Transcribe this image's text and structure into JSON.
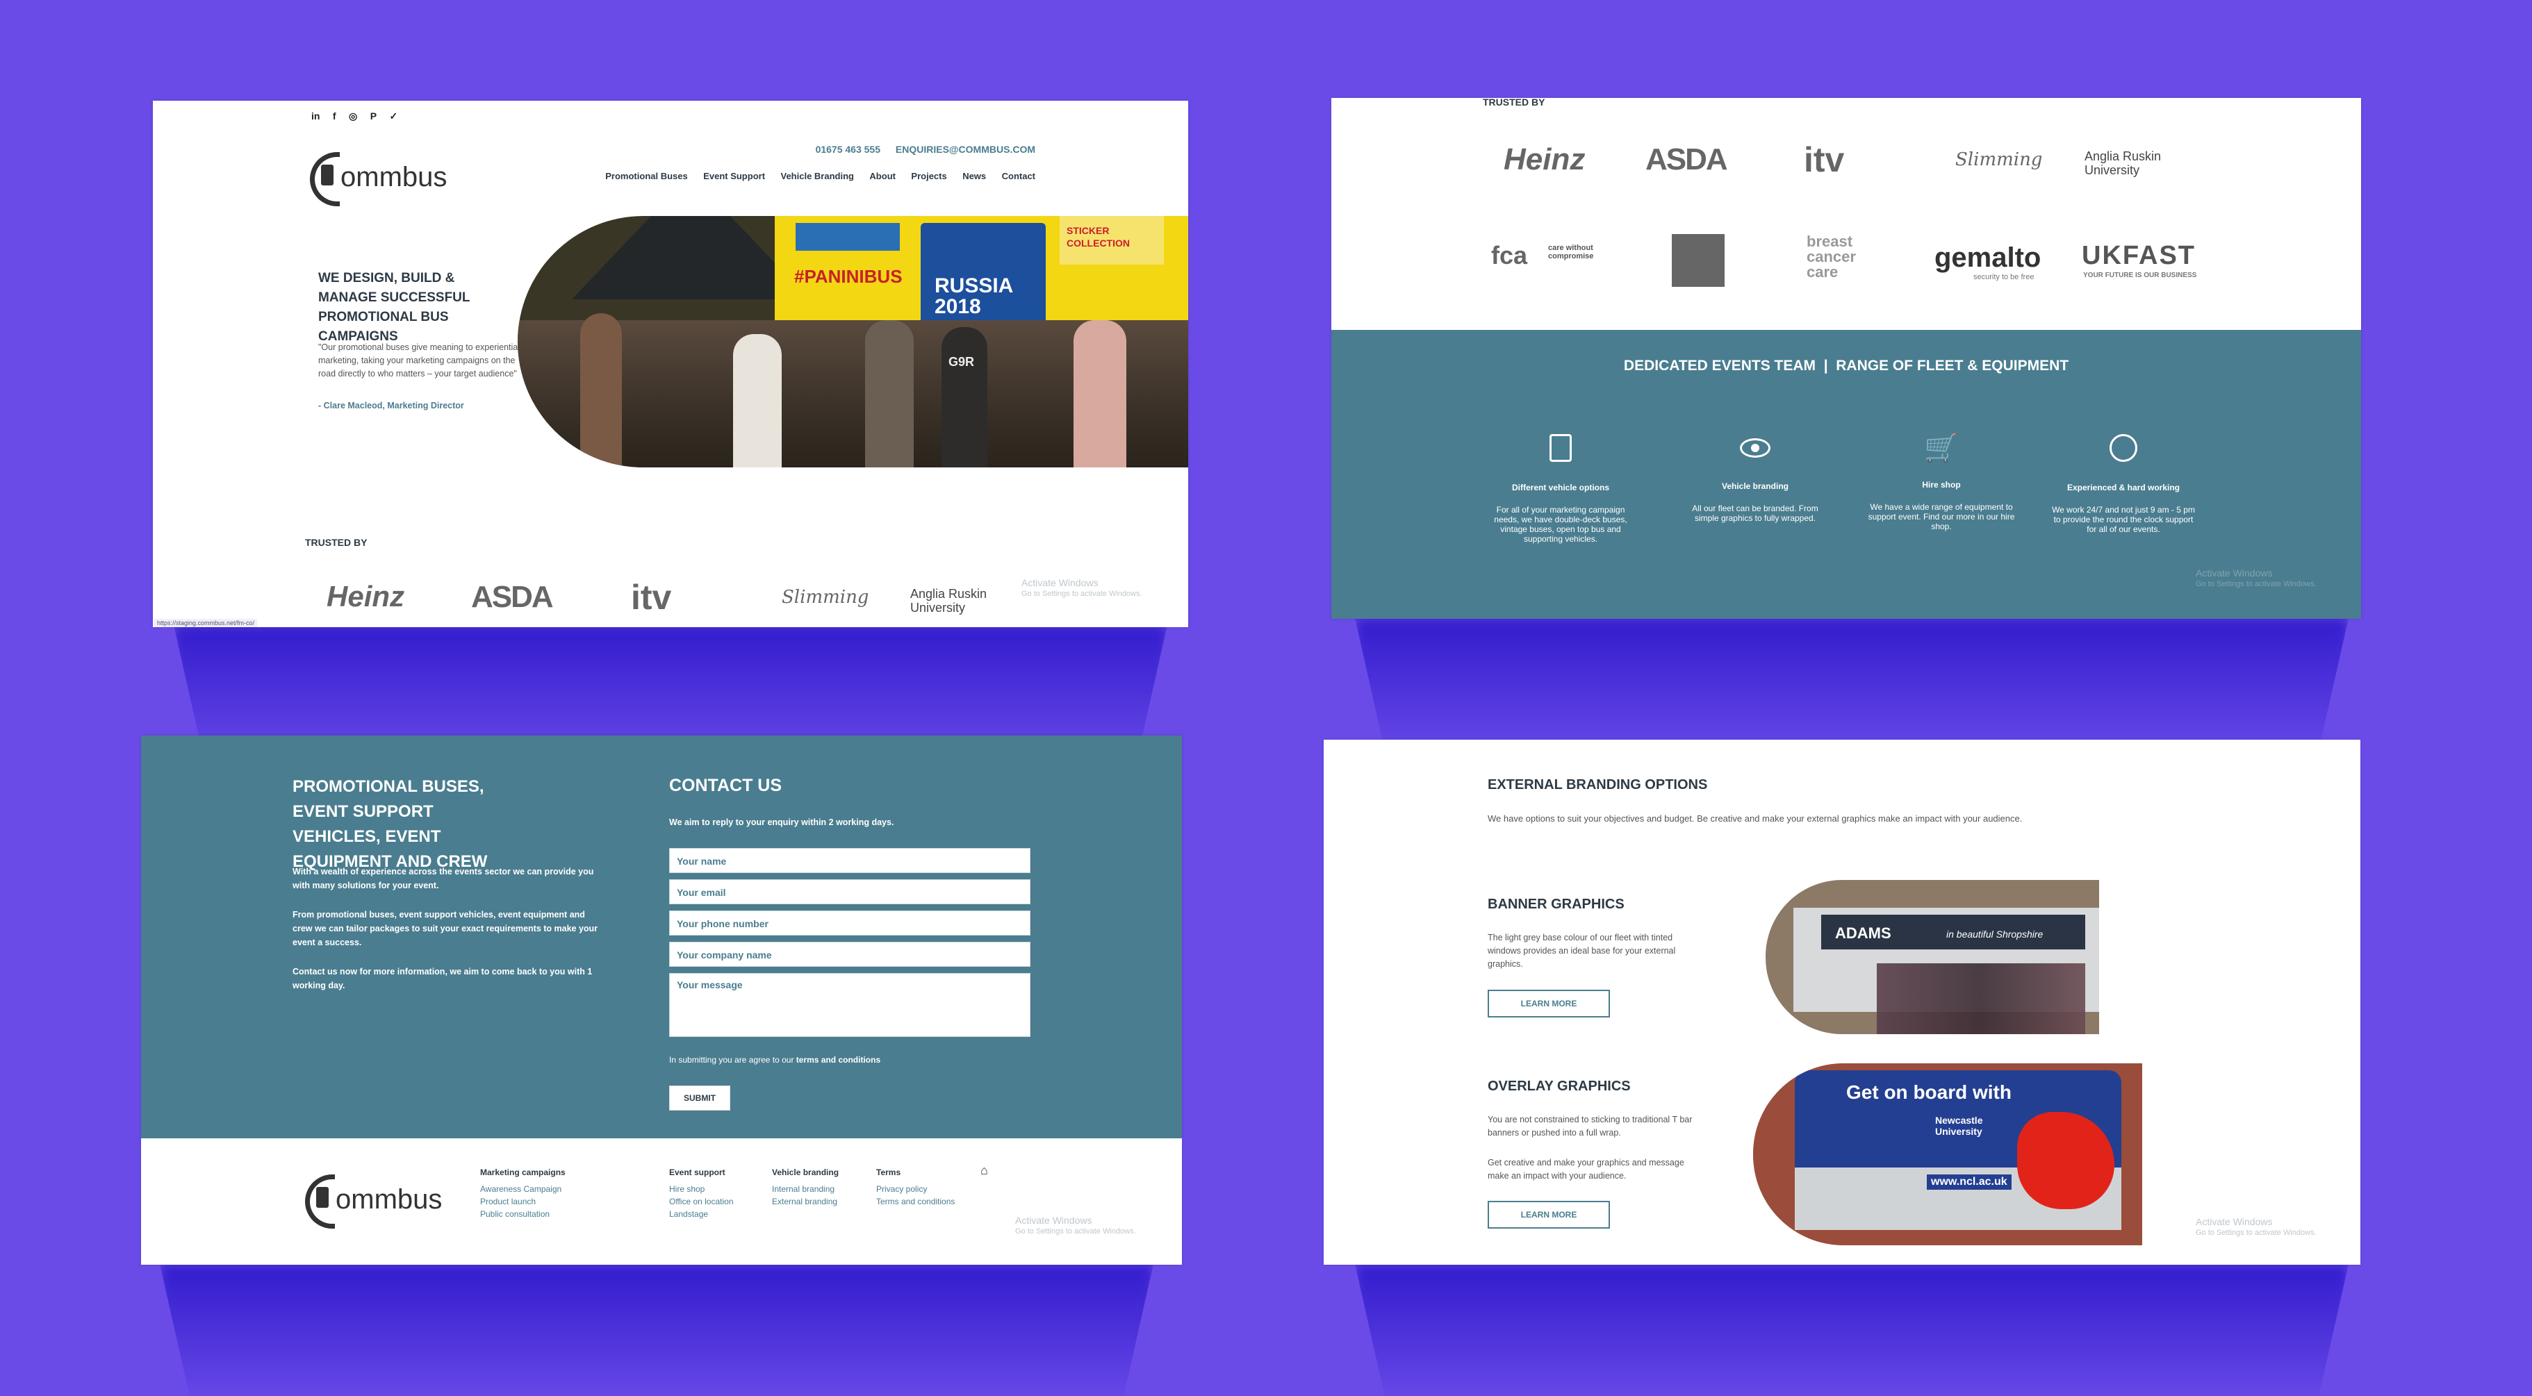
{
  "panel1": {
    "social": [
      "in",
      "f",
      "◎",
      "P",
      "✓"
    ],
    "phone": "01675 463 555",
    "email": "ENQUIRIES@COMMBUS.COM",
    "logo": "ommbus",
    "nav": [
      "Promotional Buses",
      "Event Support",
      "Vehicle Branding",
      "About",
      "Projects",
      "News",
      "Contact"
    ],
    "hero_title": "WE DESIGN, BUILD & MANAGE SUCCESSFUL PROMOTIONAL BUS CAMPAIGNS",
    "quote": "\"Our promotional buses give meaning to experiential marketing, taking your marketing campaigns on the road directly to who matters – your target audience\"",
    "quote_author": "- Clare Macleod, Marketing Director",
    "photo_texts": [
      "#PaniniBus",
      "RUSSIA 2018",
      "STICKER COLLECTION",
      "G9R"
    ],
    "trusted_by": "TRUSTED BY",
    "logos": [
      "Heinz",
      "ASDA",
      "itv",
      "Slimming",
      "Anglia Ruskin University"
    ],
    "status_url": "https://staging.commbus.net/fm-co/",
    "wm_title": "Activate Windows",
    "wm_sub": "Go to Settings to activate Windows."
  },
  "panel2": {
    "trusted_by": "TRUSTED BY",
    "logos_row1": [
      "Heinz",
      "ASDA",
      "itv",
      "Slimming",
      "Anglia Ruskin University"
    ],
    "logos_row2": [
      "fca",
      "care without compromise",
      "breast cancer care",
      "gemalto",
      "security to be free",
      "UKFAST",
      "YOUR FUTURE IS OUR BUSINESS"
    ],
    "band_title": "DEDICATED EVENTS TEAM  |  RANGE OF FLEET & EQUIPMENT",
    "features": [
      {
        "icon": "bus-icon",
        "title": "Different vehicle options",
        "text": "For all of your marketing campaign needs, we have double-deck buses, vintage buses, open top bus and supporting vehicles."
      },
      {
        "icon": "eye-icon",
        "title": "Vehicle branding",
        "text": "All our fleet can be branded. From simple graphics to fully wrapped."
      },
      {
        "icon": "cart-icon",
        "title": "Hire shop",
        "text": "We have a wide range of equipment to support event. Find our more in our hire shop."
      },
      {
        "icon": "clock-icon",
        "title": "Experienced & hard working",
        "text": "We work 24/7 and not just 9 am - 5 pm to provide the round the clock support for all of our events."
      }
    ],
    "wm_title": "Activate Windows",
    "wm_sub": "Go to Settings to activate Windows."
  },
  "panel3": {
    "left_title": "PROMOTIONAL BUSES, EVENT SUPPORT VEHICLES, EVENT EQUIPMENT AND CREW",
    "p1": "With a wealth of experience across the events sector we can provide you with many solutions for your event.",
    "p2": "From promotional buses, event support vehicles, event equipment and crew we can tailor packages to suit your exact requirements to make your event a success.",
    "p3": "Contact us now for more information, we aim to come back to you with 1 working day.",
    "contact_title": "CONTACT US",
    "contact_sub": "We aim to reply to your enquiry within 2 working days.",
    "fields": [
      "Your name",
      "Your email",
      "Your phone number",
      "Your company name"
    ],
    "message": "Your message",
    "agree_pre": "In submitting you are agree to our ",
    "agree_link": "terms and conditions",
    "submit": "SUBMIT",
    "footer": {
      "logo": "ommbus",
      "cols": [
        {
          "head": "Marketing campaigns",
          "links": [
            "Awareness Campaign",
            "Product launch",
            "Public consultation"
          ]
        },
        {
          "head": "Event support",
          "links": [
            "Hire shop",
            "Office on location",
            "Landstage"
          ]
        },
        {
          "head": "Vehicle branding",
          "links": [
            "Internal branding",
            "External branding"
          ]
        },
        {
          "head": "Terms",
          "links": [
            "Privacy policy",
            "Terms and conditions"
          ]
        }
      ],
      "home": "⌂"
    },
    "wm_title": "Activate Windows",
    "wm_sub": "Go to Settings to activate Windows."
  },
  "panel4": {
    "title": "EXTERNAL BRANDING OPTIONS",
    "intro": "We have options to suit your objectives and budget. Be creative and make your external graphics make an impact with your audience.",
    "banner_title": "BANNER GRAPHICS",
    "banner_text": "The light grey base colour of our fleet with tinted windows provides an ideal base for your external graphics.",
    "overlay_title": "OVERLAY GRAPHICS",
    "overlay_text1": "You are not constrained to sticking to traditional T bar banners or pushed into a full wrap.",
    "overlay_text2": "Get creative and make your graphics and message make an impact with your audience.",
    "learn_more": "LEARN MORE",
    "bus1_texts": [
      "ADAMS",
      "in beautiful Shropshire"
    ],
    "bus2_texts": [
      "Get on board with",
      "Newcastle University",
      "www.ncl.ac.uk"
    ],
    "wm_title": "Activate Windows",
    "wm_sub": "Go to Settings to activate Windows."
  }
}
